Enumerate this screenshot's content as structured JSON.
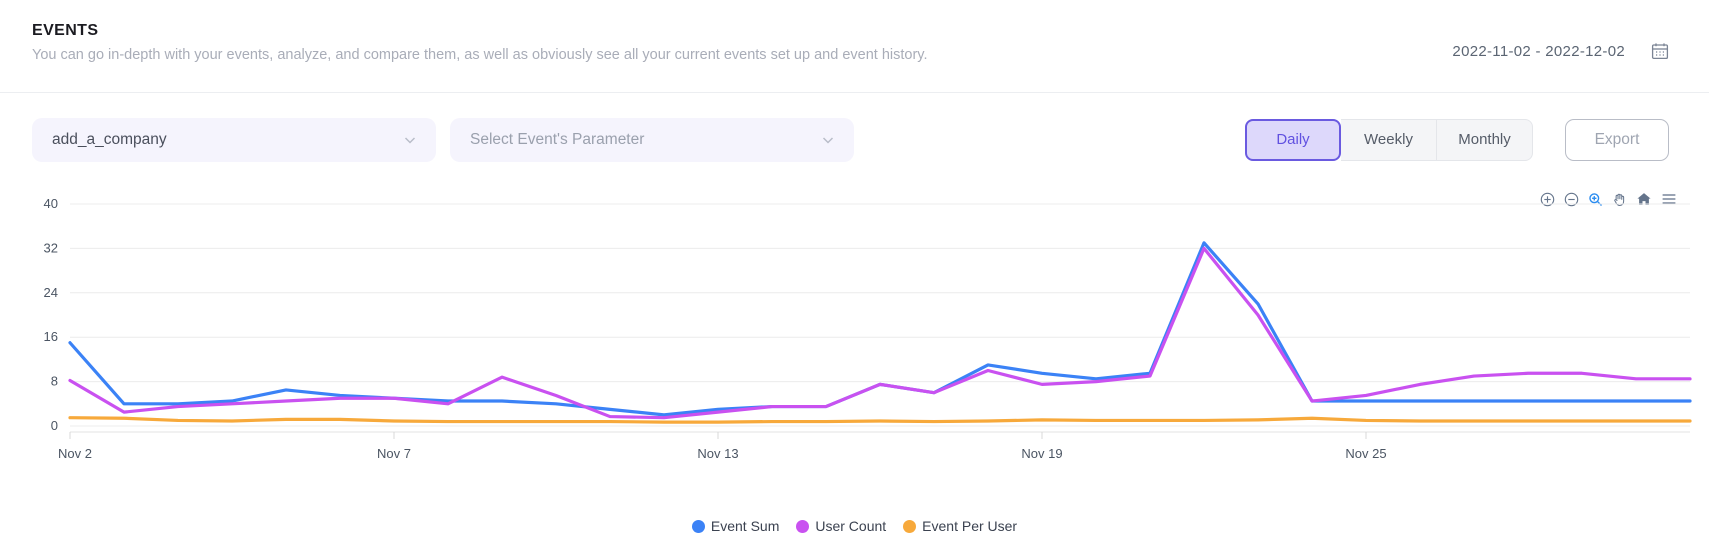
{
  "header": {
    "title": "EVENTS",
    "subtitle": "You can go in-depth with your events, analyze, and compare them, as well as obviously see all your current events set up and event history.",
    "date_range": "2022-11-02  -  2022-12-02",
    "calendar_icon": "calendar-icon"
  },
  "controls": {
    "event_select_value": "add_a_company",
    "parameter_select_placeholder": "Select Event's Parameter",
    "granularity": [
      {
        "label": "Daily",
        "active": true
      },
      {
        "label": "Weekly",
        "active": false
      },
      {
        "label": "Monthly",
        "active": false
      }
    ],
    "export_label": "Export"
  },
  "chart_toolbar": [
    {
      "name": "zoom-in-icon",
      "active": false
    },
    {
      "name": "zoom-out-icon",
      "active": false
    },
    {
      "name": "selection-zoom-icon",
      "active": true
    },
    {
      "name": "panning-icon",
      "active": false
    },
    {
      "name": "reset-zoom-icon",
      "active": false
    },
    {
      "name": "menu-icon",
      "active": false
    }
  ],
  "colors": {
    "event_sum": "#3b82f6",
    "user_count": "#c951f0",
    "event_per_user": "#f7a93b",
    "accent": "#6a5ae0",
    "accent_fill": "#ddd8fb",
    "select_bg": "#f5f4fd",
    "grid": "#ececec"
  },
  "chart_data": {
    "type": "line",
    "title": "",
    "xlabel": "",
    "ylabel": "",
    "ylim": [
      0,
      40
    ],
    "yticks": [
      0,
      8,
      16,
      24,
      32,
      40
    ],
    "grid": true,
    "legend_position": "bottom",
    "x": [
      "Nov 2",
      "Nov 3",
      "Nov 4",
      "Nov 5",
      "Nov 6",
      "Nov 7",
      "Nov 8",
      "Nov 9",
      "Nov 10",
      "Nov 11",
      "Nov 12",
      "Nov 13",
      "Nov 14",
      "Nov 15",
      "Nov 16",
      "Nov 17",
      "Nov 18",
      "Nov 19",
      "Nov 20",
      "Nov 21",
      "Nov 22",
      "Nov 23",
      "Nov 24",
      "Nov 25",
      "Nov 26",
      "Nov 27",
      "Nov 28",
      "Nov 29",
      "Nov 30",
      "Dec 1",
      "Dec 2"
    ],
    "xtick_labels": [
      "Nov 2",
      "Nov 7",
      "Nov 13",
      "Nov 19",
      "Nov 25"
    ],
    "xtick_indices": [
      0,
      6,
      12,
      18,
      24
    ],
    "series": [
      {
        "name": "Event Sum",
        "color": "#3b82f6",
        "values": [
          15,
          4,
          4,
          4.5,
          6.5,
          5.5,
          5,
          4.5,
          4.5,
          4,
          3,
          2,
          3,
          3.5,
          3.5,
          7.5,
          6,
          11,
          9.5,
          8.5,
          9.5,
          33,
          22,
          4.5,
          4.5,
          4.5,
          4.5,
          4.5,
          4.5,
          4.5,
          4.5
        ]
      },
      {
        "name": "User Count",
        "color": "#c951f0",
        "values": [
          8.2,
          2.5,
          3.5,
          4,
          4.5,
          5,
          5,
          4,
          8.8,
          5.5,
          1.7,
          1.5,
          2.5,
          3.5,
          3.5,
          7.5,
          6,
          10,
          7.5,
          8,
          9,
          32,
          20,
          4.5,
          5.5,
          7.5,
          9,
          9.5,
          9.5,
          8.5,
          8.5
        ]
      },
      {
        "name": "Event Per User",
        "color": "#f7a93b",
        "values": [
          1.5,
          1.4,
          1.0,
          0.9,
          1.2,
          1.2,
          0.9,
          0.8,
          0.8,
          0.8,
          0.8,
          0.7,
          0.7,
          0.8,
          0.8,
          0.9,
          0.8,
          0.9,
          1.1,
          1.0,
          1.0,
          1.0,
          1.1,
          1.4,
          1.0,
          0.9,
          0.9,
          0.9,
          0.9,
          0.9,
          0.9
        ]
      }
    ]
  }
}
